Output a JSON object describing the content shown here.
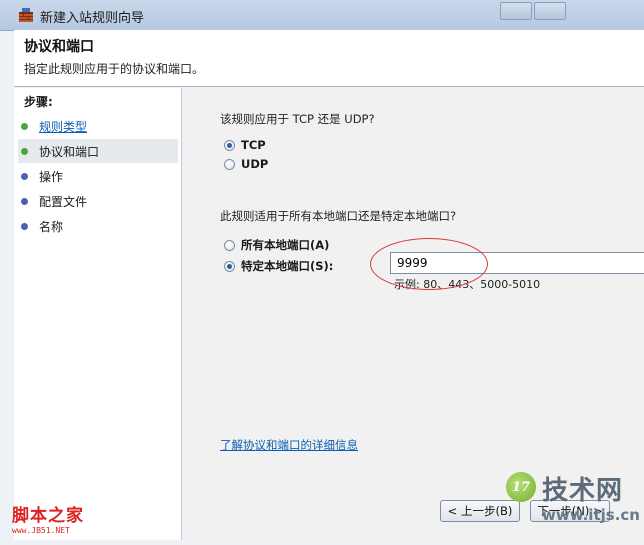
{
  "window": {
    "title": "新建入站规则向导"
  },
  "header": {
    "title": "协议和端口",
    "description": "指定此规则应用于的协议和端口。"
  },
  "sidebar": {
    "steps_title": "步骤:",
    "items": [
      {
        "label": "规则类型",
        "state": "link",
        "dot_color": "#4aa63a"
      },
      {
        "label": "协议和端口",
        "state": "current",
        "dot_color": "#4aa63a"
      },
      {
        "label": "操作",
        "state": "normal",
        "dot_color": "#4c5fb8"
      },
      {
        "label": "配置文件",
        "state": "normal",
        "dot_color": "#4c5fb8"
      },
      {
        "label": "名称",
        "state": "normal",
        "dot_color": "#4c5fb8"
      }
    ]
  },
  "main": {
    "protocol_question": "该规则应用于 TCP 还是 UDP?",
    "protocol_options": [
      {
        "label": "TCP",
        "checked": true
      },
      {
        "label": "UDP",
        "checked": false
      }
    ],
    "port_question": "此规则适用于所有本地端口还是特定本地端口?",
    "port_options": [
      {
        "label": "所有本地端口(A)",
        "checked": false
      },
      {
        "label": "特定本地端口(S):",
        "checked": true
      }
    ],
    "port_value": "9999",
    "port_example": "示例: 80、443、5000-5010",
    "detail_link": "了解协议和端口的详细信息"
  },
  "buttons": {
    "back": "< 上一步(B)",
    "next": "下一步(N) >"
  },
  "watermarks": {
    "left_brand": "脚本之家",
    "left_url": "www.JB51.NET",
    "right_badge": "17",
    "right_brand": "技术网",
    "right_url": "www.itjs.cn"
  },
  "colors": {
    "link": "#0a5fb4",
    "annotation": "#d83a3a"
  }
}
